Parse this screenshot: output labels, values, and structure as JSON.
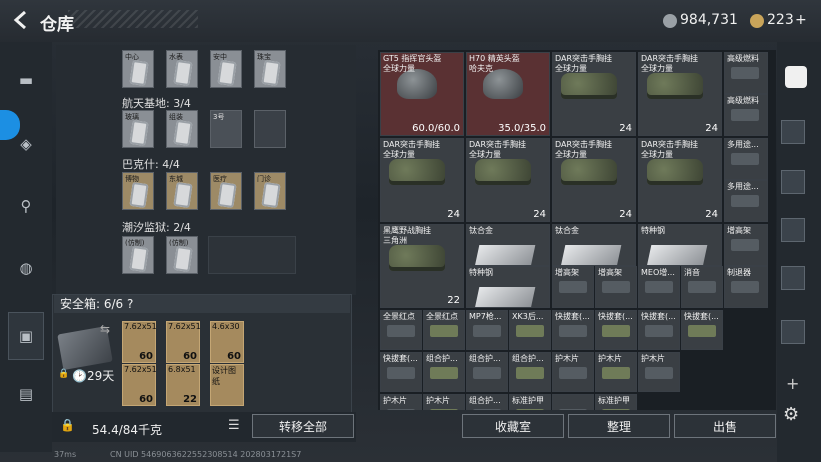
{
  "header": {
    "title": "仓库",
    "currency1": "984,731",
    "currency2": "223",
    "plus": "+"
  },
  "side_nav": {
    "icons": [
      "pistol-icon",
      "armor-icon",
      "backpack-icon",
      "bag-icon",
      "clipboard-icon",
      "briefcase-icon"
    ]
  },
  "groups": [
    {
      "label": "",
      "slots": [
        "中心",
        "水表",
        "安中",
        "珠宝"
      ]
    },
    {
      "label": "航天基地: 3/4",
      "slots": [
        "玻璃",
        "组装",
        "3号"
      ]
    },
    {
      "label": "巴克什: 4/4",
      "slots": [
        "博物",
        "东城",
        "医疗",
        "门诊"
      ]
    },
    {
      "label": "潮汐监狱: 2/4",
      "slots": [
        "(仿制)",
        "(仿制)"
      ]
    }
  ],
  "safe": {
    "label": "安全箱: 6/6",
    "help": "?",
    "days": "29天",
    "items": [
      {
        "label": "7.62x51",
        "sub": "M",
        "count": "60"
      },
      {
        "label": "7.62x51",
        "sub": "M",
        "count": "60"
      },
      {
        "label": "4.6x30",
        "sub": "",
        "count": "60"
      },
      {
        "label": "7.62x51",
        "sub": "M",
        "count": "60"
      },
      {
        "label": "6.8x51",
        "sub": "H",
        "count": "22"
      },
      {
        "label": "设计图纸",
        "sub": "",
        "count": ""
      }
    ]
  },
  "capacity": "54.4/84千克",
  "buttons": {
    "transfer_all": "转移全部",
    "collect": "收藏室",
    "organize": "整理",
    "sell": "出售"
  },
  "grid": {
    "row1": [
      {
        "t1": "GT5 指挥官头盔",
        "t2": "全球力量",
        "q": "60.0/60.0"
      },
      {
        "t1": "H70 精英头盔",
        "t2": "哈夫克",
        "q": "35.0/35.0"
      },
      {
        "t1": "DAR突击手胸挂",
        "t2": "全球力量",
        "q": "24"
      },
      {
        "t1": "DAR突击手胸挂",
        "t2": "全球力量",
        "q": "24"
      },
      {
        "t1": "高级燃料",
        "q": ""
      },
      {
        "t1": "高级燃料",
        "q": ""
      }
    ],
    "row2": [
      {
        "t1": "DAR突击手胸挂",
        "t2": "全球力量",
        "q": "24"
      },
      {
        "t1": "DAR突击手胸挂",
        "t2": "全球力量",
        "q": "24"
      },
      {
        "t1": "DAR突击手胸挂",
        "t2": "全球力量",
        "q": "24"
      },
      {
        "t1": "DAR突击手胸挂",
        "t2": "全球力量",
        "q": "24"
      },
      {
        "t1": "多用途..."
      },
      {
        "t1": "多用途..."
      }
    ],
    "row3": [
      {
        "t1": "黑鹰野战胸挂",
        "t2": "三角洲",
        "q": "22"
      },
      {
        "t1": "钛合金"
      },
      {
        "t1": "钛合金"
      },
      {
        "t1": "特种钢"
      },
      {
        "t1": "增高架"
      },
      {
        "t1": "特种钢"
      },
      {
        "t1": "增高架"
      },
      {
        "t1": "增高架"
      },
      {
        "t1": "MEO增..."
      },
      {
        "t1": "消音"
      },
      {
        "t1": "制退器"
      }
    ],
    "row4": [
      "全景红点",
      "全景红点",
      "MP7枪...",
      "XK3后...",
      "快拔套(...",
      "快拔套(...",
      "快拔套(...",
      "快拔套(..."
    ],
    "row5": [
      "快拔套(...",
      "组合护...",
      "组合护...",
      "组合护...",
      "护木片",
      "护木片",
      "护木片"
    ],
    "row6": [
      "护木片",
      "护木片",
      "组合护...",
      "标准护甲",
      "",
      "标准护甲"
    ]
  },
  "status": {
    "ping": "37ms",
    "uid": "CN UID 5469063622552308514 2028031721S7"
  }
}
